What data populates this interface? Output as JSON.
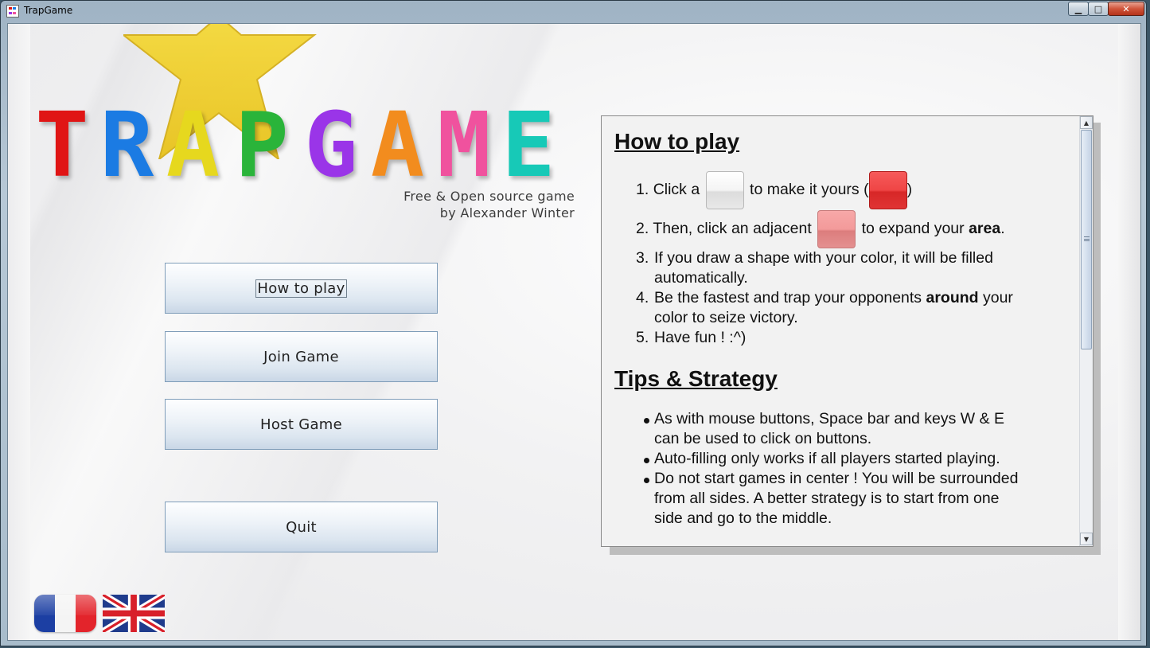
{
  "window": {
    "title": "TrapGame",
    "minimize": "▁",
    "maximize": "□",
    "close": "✕"
  },
  "logo": {
    "letters": [
      {
        "ch": "T",
        "color": "#e01515"
      },
      {
        "ch": "R",
        "color": "#1b7be3"
      },
      {
        "ch": "A",
        "color": "#ece020"
      },
      {
        "ch": "P",
        "color": "#2ab43a"
      },
      {
        "ch": "G",
        "color": "#9a35e8"
      },
      {
        "ch": "A",
        "color": "#f28c1e"
      },
      {
        "ch": "M",
        "color": "#f0529e"
      },
      {
        "ch": "E",
        "color": "#17c9b7"
      }
    ],
    "subtitle_line1": "Free & Open source game",
    "subtitle_line2": "by Alexander Winter"
  },
  "menu": {
    "how_to_play": "How to play",
    "join_game": "Join Game",
    "host_game": "Host Game",
    "quit": "Quit"
  },
  "flags": {
    "french": "flag-france-icon",
    "english": "flag-uk-icon"
  },
  "help": {
    "how_heading": "How to play",
    "step1_num": "1.",
    "step1_a": "Click a",
    "step1_b": "to make it yours (",
    "step1_c": ")",
    "step2_num": "2.",
    "step2_a": "Then, click an adjacent",
    "step2_b": "to expand your ",
    "step2_bold": "area",
    "step2_c": ".",
    "step3_num": "3.",
    "step3_l1": "If you draw a shape with your color, it will be filled",
    "step3_l2": "automatically.",
    "step4_num": "4.",
    "step4_a": "Be the fastest and trap your opponents ",
    "step4_bold": "around",
    "step4_b": " your",
    "step4_l2": "color to seize victory.",
    "step5_num": "5.",
    "step5": "Have fun ! :^)",
    "tips_heading": "Tips & Strategy",
    "tip1_l1": "As with mouse buttons, Space bar and keys W & E",
    "tip1_l2": "can be used to click on buttons.",
    "tip2_l1": "Auto-filling only works if all players started playing.",
    "tip3_l1": "Do not start games in center ! You will be surrounded",
    "tip3_l2": "from all sides. A better strategy is to start from one",
    "tip3_l3": "side and go to the middle."
  },
  "scrollbar": {
    "up_arrow": "▲",
    "down_arrow": "▼",
    "scroll_fraction": 0.0
  }
}
